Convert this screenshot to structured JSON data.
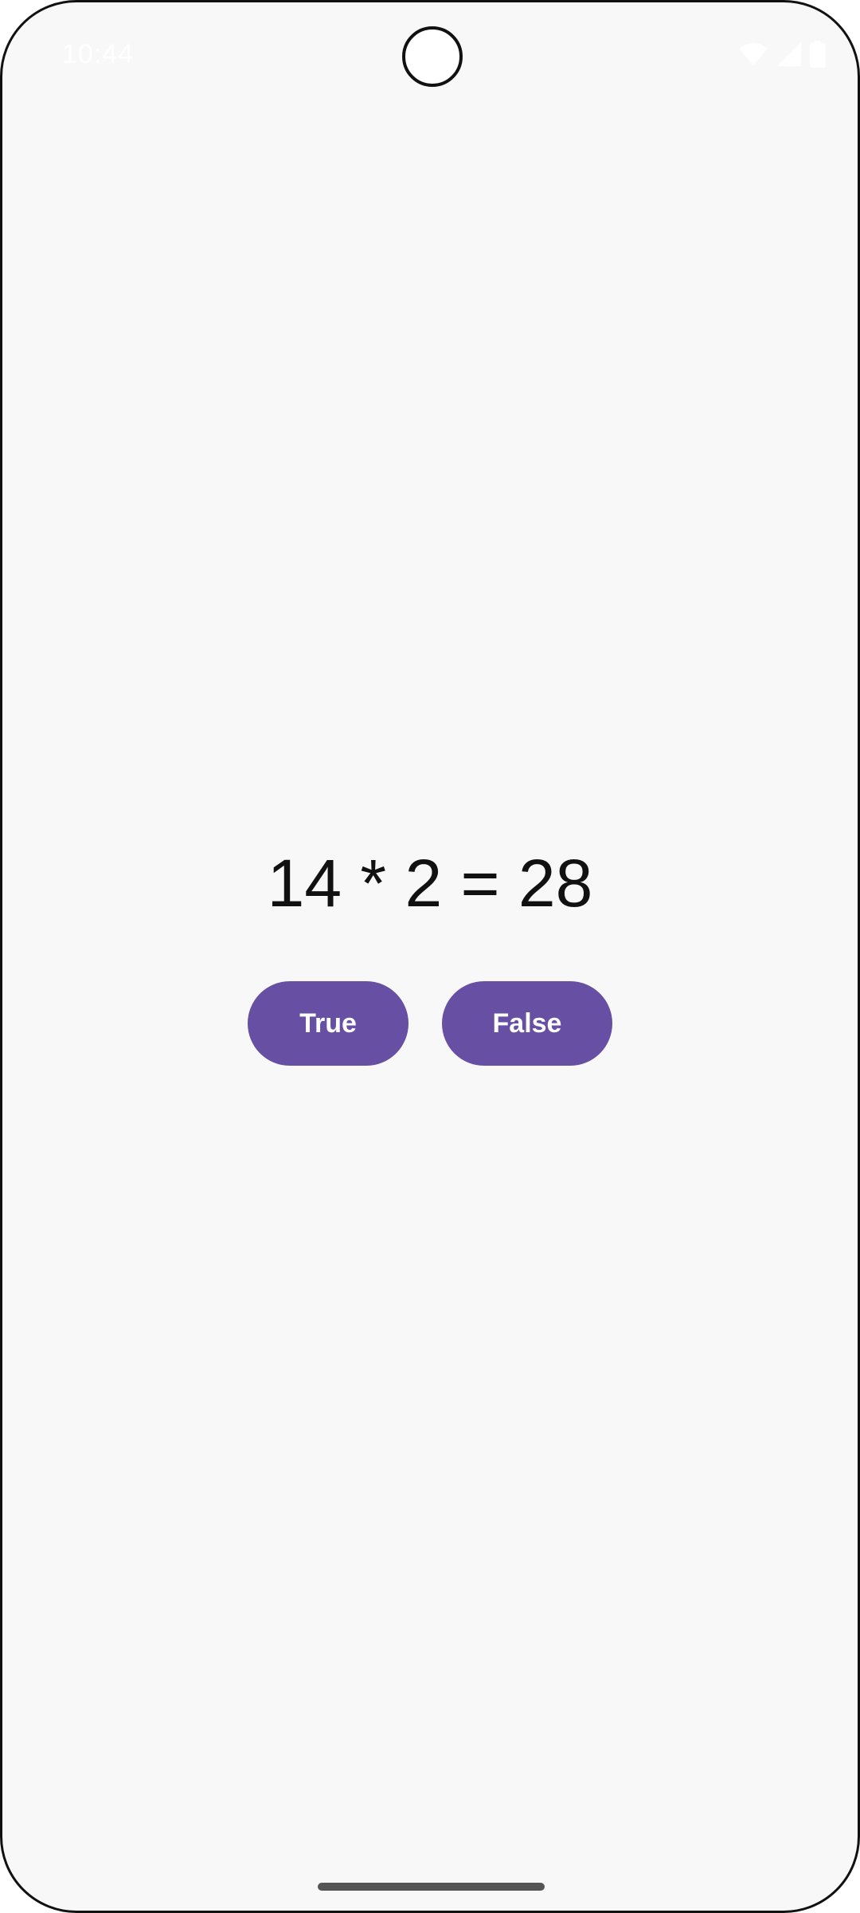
{
  "status_bar": {
    "time": "10:44",
    "icons": [
      "wifi-icon",
      "cellular-signal-icon",
      "battery-icon"
    ]
  },
  "quiz": {
    "question": "14 * 2 = 28",
    "true_label": "True",
    "false_label": "False"
  },
  "colors": {
    "button": "#674fa4",
    "background": "#f8f8f9"
  }
}
